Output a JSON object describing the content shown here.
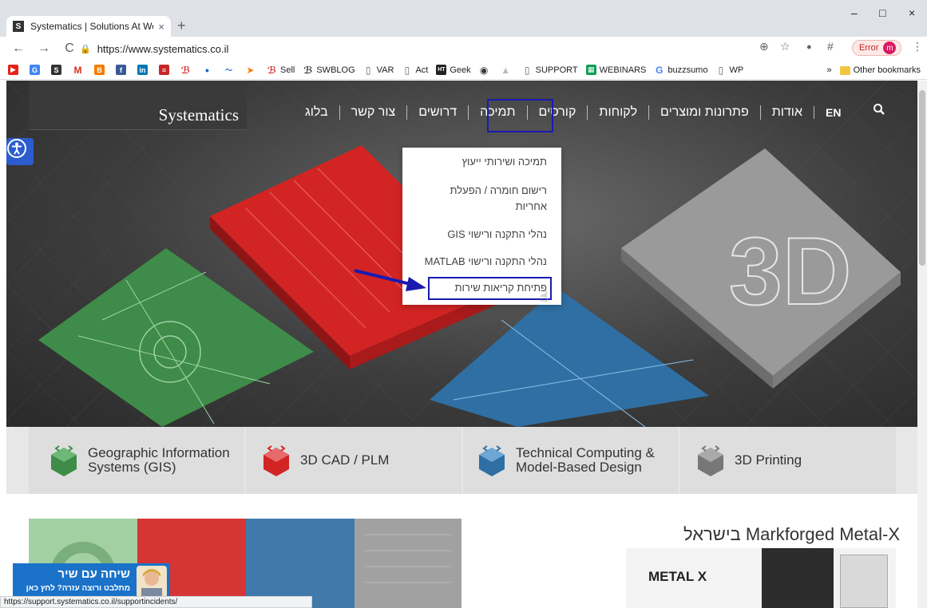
{
  "browser": {
    "tab_title": "Systematics | Solutions At Works",
    "favicon_letter": "S",
    "tab_close": "×",
    "new_tab": "+",
    "url": "https://www.systematics.co.il",
    "error_label": "Error",
    "profile_letter": "m",
    "window_controls": [
      "–",
      "□",
      "×"
    ]
  },
  "bookmarks": {
    "items": [
      "Sell",
      "SWBLOG",
      "VAR",
      "Act",
      "Geek",
      "SUPPORT",
      "WEBINARS",
      "buzzsumo",
      "WP"
    ],
    "overflow": "»",
    "other": "Other bookmarks"
  },
  "site": {
    "logo": "Systematics",
    "nav": [
      "בלוג",
      "צור קשר",
      "דרושים",
      "תמיכה",
      "קורסים",
      "לקוחות",
      "פתרונות ומוצרים",
      "אודות"
    ],
    "lang": "EN",
    "dropdown": [
      "תמיכה ושירותי ייעוץ",
      "רישום חומרה / הפעלת",
      "אחריות",
      "נהלי התקנה ורישוי GIS",
      "נהלי התקנה ורישוי MATLAB",
      "פתיחת קריאות שירות"
    ],
    "categories": [
      {
        "l1": "Geographic Information",
        "l2": "Systems (GIS)"
      },
      {
        "l1": "3D CAD / PLM",
        "l2": ""
      },
      {
        "l1": "Technical Computing &",
        "l2": "Model-Based Design"
      },
      {
        "l1": "3D Printing",
        "l2": ""
      }
    ],
    "promo_title": "Markforged Metal-X בישראל",
    "metal_x": "METAL X",
    "chat_title": "שיחה עם שיר",
    "chat_sub": "מתלבט ורוצה עזרה? לחץ כאן",
    "hero_3d": "3D"
  },
  "status_url": "https://support.systematics.co.il/supportincidents/",
  "colors": {
    "highlight": "#1a1ab0",
    "accessibility": "#2b5dcf",
    "chat": "#1a72c9"
  }
}
